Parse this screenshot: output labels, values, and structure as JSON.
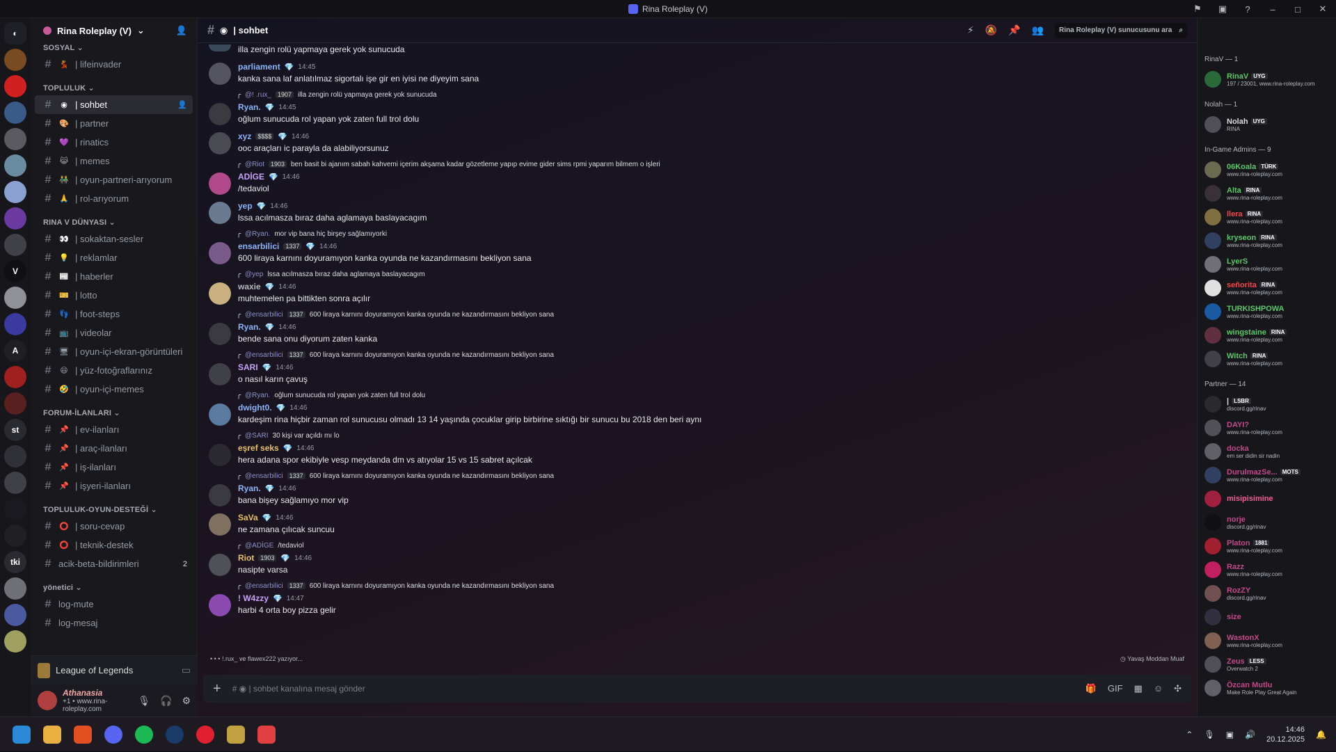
{
  "window": {
    "title": "Rina Roleplay (V)"
  },
  "server": {
    "name": "Rina Roleplay (V)"
  },
  "categories": [
    {
      "name": "SOSYAL ⌄",
      "channels": [
        {
          "emoji": "💃",
          "name": "| lifeinvader"
        }
      ]
    },
    {
      "name": "TOPLULUK ⌄",
      "channels": [
        {
          "emoji": "◉",
          "name": "| sohbet",
          "active": true
        },
        {
          "emoji": "🎨",
          "name": "| partner"
        },
        {
          "emoji": "💜",
          "name": "| rinatics"
        },
        {
          "emoji": "😹",
          "name": "| memes"
        },
        {
          "emoji": "👬",
          "name": "| oyun-partneri-arıyorum"
        },
        {
          "emoji": "🙏",
          "name": "| rol-arıyorum"
        }
      ]
    },
    {
      "name": "RINA V DÜNYASI ⌄",
      "channels": [
        {
          "emoji": "👀",
          "name": "| sokaktan-sesler"
        },
        {
          "emoji": "💡",
          "name": "| reklamlar"
        },
        {
          "emoji": "📰",
          "name": "| haberler"
        },
        {
          "emoji": "🎫",
          "name": "| lotto"
        },
        {
          "emoji": "👣",
          "name": "| foot-steps"
        },
        {
          "emoji": "📺",
          "name": "| videolar"
        },
        {
          "emoji": "🖥",
          "name": "| oyun-içi-ekran-görüntüleri"
        },
        {
          "emoji": "😄",
          "name": "| yüz-fotoğraflarınız"
        },
        {
          "emoji": "🤣",
          "name": "| oyun-içi-memes"
        }
      ]
    },
    {
      "name": "FORUM-İLANLARI ⌄",
      "channels": [
        {
          "emoji": "📌",
          "name": "| ev-ilanları"
        },
        {
          "emoji": "📌",
          "name": "| araç-ilanları"
        },
        {
          "emoji": "📌",
          "name": "| iş-ilanları"
        },
        {
          "emoji": "📌",
          "name": "| işyeri-ilanları"
        }
      ]
    },
    {
      "name": "TOPLULUK-OYUN-DESTEĞİ ⌄",
      "channels": [
        {
          "emoji": "⭕",
          "name": "| soru-cevap"
        },
        {
          "emoji": "⭕",
          "name": "| teknik-destek"
        },
        {
          "emoji": "",
          "name": "acik-beta-bildirimleri",
          "badge": "2"
        }
      ]
    },
    {
      "name": "yönetici ⌄",
      "channels": [
        {
          "emoji": "",
          "name": "log-mute"
        },
        {
          "emoji": "",
          "name": "log-mesaj"
        }
      ]
    }
  ],
  "voice": {
    "game": "League of Legends"
  },
  "user": {
    "name": "Athanasia",
    "status": "+1 • www.rina-roleplay.com"
  },
  "channel": {
    "title": "| sohbet",
    "search_placeholder": "Rina Roleplay (V) sunucusunu ara",
    "composer_placeholder": "| sohbet kanalına mesaj gönder"
  },
  "top_text": "illa zengin rolü yapmaya gerek yok sunucuda",
  "messages": [
    {
      "author": "parliament",
      "color": "#8ab4f8",
      "tag": "",
      "time": "14:45",
      "text": "kanka sana laf anlatılmaz sigortalı işe gir en iyisi ne diyeyim sana",
      "avatar": "#555560"
    },
    {
      "reply_to": "@! .rux_",
      "reply_tag": "1907",
      "reply_text": "illa zengin rolü yapmaya gerek yok sunucuda",
      "author": "Ryan.",
      "color": "#8ab4f8",
      "tag": "",
      "time": "14:45",
      "text": "oğlum sunucuda rol yapan yok zaten full trol dolu",
      "avatar": "#3a3a40"
    },
    {
      "author": "xyz",
      "color": "#8ab4f8",
      "tag": "$$$$",
      "time": "14:46",
      "text": "ooc araçları ic parayla da alabiliyorsunuz",
      "avatar": "#4a4a52"
    },
    {
      "reply_to": "@Riot",
      "reply_tag": "1903",
      "reply_text": "ben basit bi ajanım sabah kahvemi içerim akşama kadar gözetleme yapıp evime gider sims rpmi yaparım bilmem o işleri",
      "author": "ADİGE",
      "color": "#c8a2f8",
      "tag": "",
      "time": "14:46",
      "text": "/tedaviol",
      "avatar": "#b04a8a"
    },
    {
      "author": "yep",
      "color": "#8ab4f8",
      "tag": "",
      "time": "14:46",
      "text": "lssa acılmasza bıraz daha aglamaya baslayacagım",
      "avatar": "#6a7a90"
    },
    {
      "reply_to": "@Ryan.",
      "reply_tag": "",
      "reply_text": "mor vip bana hiç birşey sağlamıyorki",
      "author": "ensarbilici",
      "color": "#8ab4f8",
      "tag": "1337",
      "time": "14:46",
      "text": "600 liraya karnını doyuramıyon kanka oyunda ne kazandırmasını bekliyon sana",
      "avatar": "#7a5a8a"
    },
    {
      "reply_to": "@yep",
      "reply_tag": "",
      "reply_text": "lssa acılmasza bıraz daha aglamaya baslayacagım",
      "author": "waxie",
      "color": "#b5bac1",
      "tag": "",
      "time": "14:46",
      "text": "muhtemelen pa bittikten sonra açılır",
      "avatar": "#c8b080"
    },
    {
      "reply_to": "@ensarbilici",
      "reply_tag": "1337",
      "reply_text": "600 liraya karnını doyuramıyon kanka oyunda ne kazandırmasını bekliyon sana",
      "author": "Ryan.",
      "color": "#8ab4f8",
      "tag": "",
      "time": "14:46",
      "text": "bende sana onu diyorum zaten kanka",
      "avatar": "#3a3a40"
    },
    {
      "reply_to": "@ensarbilici",
      "reply_tag": "1337",
      "reply_text": "600 liraya karnını doyuramıyon kanka oyunda ne kazandırmasını bekliyon sana",
      "author": "SARI",
      "color": "#c8a2f8",
      "tag": "",
      "time": "14:46",
      "text": "o nasıl karın çavuş",
      "avatar": "#404048"
    },
    {
      "reply_to": "@Ryan.",
      "reply_tag": "",
      "reply_text": "oğlum sunucuda rol yapan yok zaten full trol dolu",
      "author": "dwight0.",
      "color": "#8ab4f8",
      "tag": "",
      "time": "14:46",
      "text": "kardeşim rina hiçbir zaman rol sunucusu olmadı 13 14 yaşında çocuklar girip birbirine sıktığı bir sunucu bu 2018 den beri aynı",
      "avatar": "#5a7aa0"
    },
    {
      "reply_to": "@SARI",
      "reply_tag": "",
      "reply_text": "30 kişi var açıldı mı lo",
      "author": "eşref seks",
      "color": "#e8c060",
      "tag": "",
      "time": "14:46",
      "text": "hera adana spor ekibiyle vesp meydanda dm vs atıyolar 15 vs 15 sabret açılcak",
      "avatar": "#2a2a30"
    },
    {
      "reply_to": "@ensarbilici",
      "reply_tag": "1337",
      "reply_text": "600 liraya karnını doyuramıyon kanka oyunda ne kazandırmasını bekliyon sana",
      "author": "Ryan.",
      "color": "#8ab4f8",
      "tag": "",
      "time": "14:46",
      "text": "bana bişey sağlamıyo mor vip",
      "avatar": "#3a3a40"
    },
    {
      "author": "SaVa",
      "color": "#e8c060",
      "tag": "",
      "time": "14:46",
      "text": "ne zamana çılıcak suncuu",
      "avatar": "#807060"
    },
    {
      "reply_to": "@ADİGE",
      "reply_tag": "",
      "reply_text": "/tedaviol",
      "author": "Riot",
      "color": "#e8c060",
      "tag": "1903",
      "time": "14:46",
      "text": "nasipte varsa",
      "avatar": "#505058"
    },
    {
      "reply_to": "@ensarbilici",
      "reply_tag": "1337",
      "reply_text": "600 liraya karnını doyuramıyon kanka oyunda ne kazandırmasını bekliyon sana",
      "author": "! W4zzy",
      "color": "#c8a2f8",
      "tag": "",
      "time": "14:47",
      "text": "harbi 4 orta boy pizza gelir",
      "avatar": "#8a4ab0"
    }
  ],
  "typing": "!.rux_ ve flawex222 yazıyor...",
  "slowmode": "Yavaş Moddan Muaf",
  "member_groups": [
    {
      "title": "RinaV — 1",
      "members": [
        {
          "name": "RinaV",
          "tag": "UYG",
          "status": "197 / 23001, www.rina-roleplay.com",
          "color": "#5cc86a",
          "avatar": "#2a6a3a"
        }
      ]
    },
    {
      "title": "Nolah — 1",
      "members": [
        {
          "name": "Nolah",
          "tag": "UYG",
          "status": "RINA",
          "color": "#dbdee1",
          "avatar": "#505058"
        }
      ]
    },
    {
      "title": "In-Game Admins — 9",
      "members": [
        {
          "name": "06Koala",
          "tag": "TÜRK",
          "status": "www.rina-roleplay.com",
          "color": "#5cc86a",
          "avatar": "#6a6a50"
        },
        {
          "name": "Alta",
          "tag": "RINA",
          "status": "www.rina-roleplay.com",
          "color": "#5cc86a",
          "avatar": "#3a3038"
        },
        {
          "name": "llera",
          "tag": "RINA",
          "status": "www.rina-roleplay.com",
          "color": "#f04848",
          "avatar": "#807040"
        },
        {
          "name": "kryseon",
          "tag": "RINA",
          "status": "www.rina-roleplay.com",
          "color": "#5cc86a",
          "avatar": "#304060"
        },
        {
          "name": "LyerS",
          "tag": "",
          "status": "www.rina-roleplay.com",
          "color": "#5cc86a",
          "avatar": "#707078"
        },
        {
          "name": "señorita",
          "tag": "RINA",
          "status": "www.rina-roleplay.com",
          "color": "#f04848",
          "avatar": "#e0e0e0"
        },
        {
          "name": "TURKISHPOWA",
          "tag": "",
          "status": "www.rina-roleplay.com",
          "color": "#5cc86a",
          "avatar": "#1a5aa0"
        },
        {
          "name": "wingstaine",
          "tag": "RINA",
          "status": "www.rina-roleplay.com",
          "color": "#5cc86a",
          "avatar": "#603040"
        },
        {
          "name": "Witch",
          "tag": "RINA",
          "status": "www.rina-roleplay.com",
          "color": "#5cc86a",
          "avatar": "#404048"
        }
      ]
    },
    {
      "title": "Partner — 14",
      "members": [
        {
          "name": "|",
          "tag": "LSBR",
          "status": "discord.gg/rinav",
          "color": "#dbdee1",
          "avatar": "#2a2a30"
        },
        {
          "name": "DAYI?",
          "tag": "",
          "status": "www.rina-roleplay.com",
          "color": "#c04a8a",
          "avatar": "#505058"
        },
        {
          "name": "docka",
          "tag": "",
          "status": "em ser didin sir nadin",
          "color": "#c04a8a",
          "avatar": "#606068"
        },
        {
          "name": "DurulmazSe...",
          "tag": "MOTS",
          "status": "www.rina-roleplay.com",
          "color": "#c04a8a",
          "avatar": "#304060"
        },
        {
          "name": "misipisimine",
          "tag": "",
          "status": "",
          "color": "#f06090",
          "avatar": "#a02040"
        },
        {
          "name": "norje",
          "tag": "",
          "status": "discord.gg/rinav",
          "color": "#c04a8a",
          "avatar": "#101014"
        },
        {
          "name": "Platon",
          "tag": "1881",
          "status": "www.rina-roleplay.com",
          "color": "#c04a8a",
          "avatar": "#a02030"
        },
        {
          "name": "Razz",
          "tag": "",
          "status": "www.rina-roleplay.com",
          "color": "#c04a8a",
          "avatar": "#c02060"
        },
        {
          "name": "RozZY",
          "tag": "",
          "status": "discord.gg/rinav",
          "color": "#c04a8a",
          "avatar": "#705050"
        },
        {
          "name": "size",
          "tag": "",
          "status": "",
          "color": "#c04a8a",
          "avatar": "#303040"
        },
        {
          "name": "WastonX",
          "tag": "",
          "status": "www.rina-roleplay.com",
          "color": "#c04a8a",
          "avatar": "#806050"
        },
        {
          "name": "Zeus",
          "tag": "LESS",
          "status": "Overwatch 2",
          "color": "#c04a8a",
          "avatar": "#505058"
        },
        {
          "name": "Özcan Mutlu",
          "tag": "",
          "status": "Make Role Play Great Again",
          "color": "#c04a8a",
          "avatar": "#606068"
        }
      ]
    }
  ],
  "taskbar": {
    "time": "14:46",
    "date": "20.12.2025"
  }
}
